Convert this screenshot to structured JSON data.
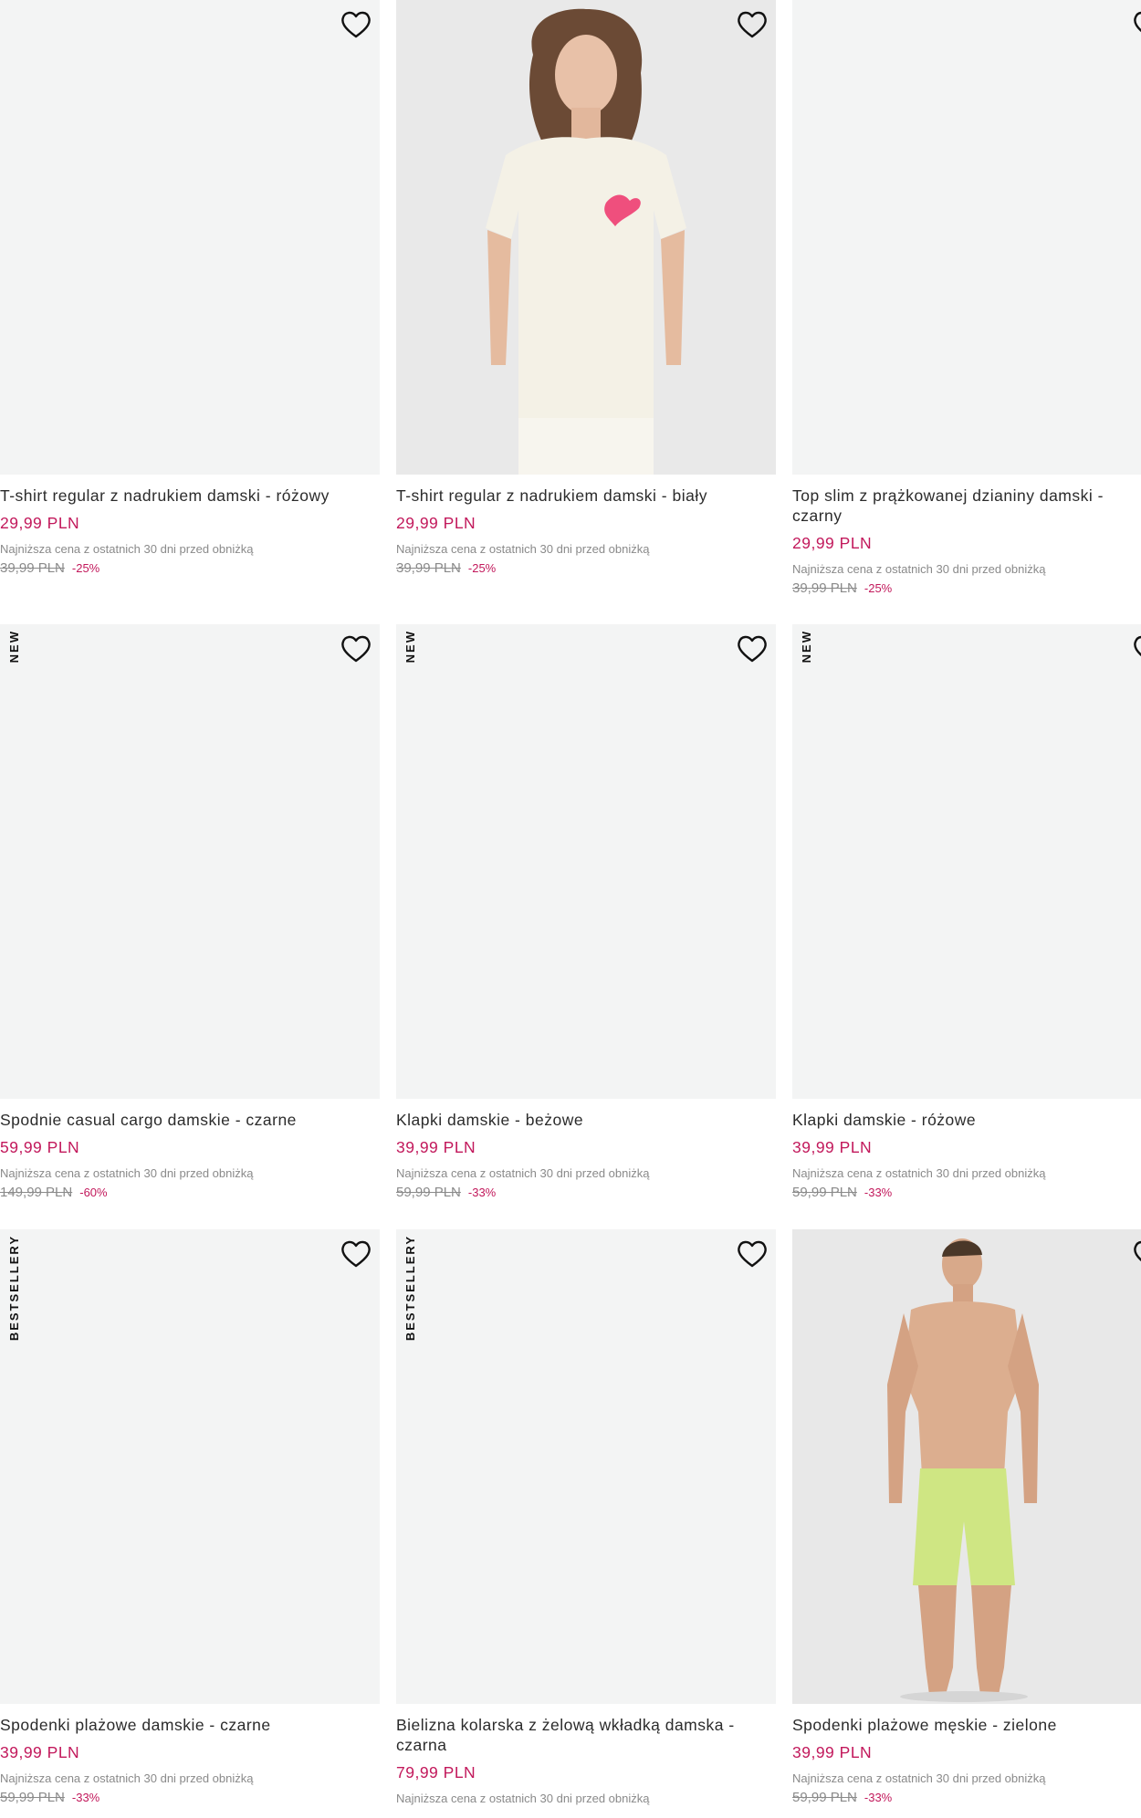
{
  "products": [
    {
      "title": "T-shirt regular z nadrukiem damski - różowy",
      "price": "29,99 PLN",
      "lowest_price_label": "Najniższa cena z ostatnich 30 dni przed obniżką",
      "old_price": "39,99 PLN",
      "discount": "-25%",
      "badge": "",
      "image": "empty"
    },
    {
      "title": "T-shirt regular z nadrukiem damski - biały",
      "price": "29,99 PLN",
      "lowest_price_label": "Najniższa cena z ostatnich 30 dni przed obniżką",
      "old_price": "39,99 PLN",
      "discount": "-25%",
      "badge": "",
      "image": "woman-white-tshirt"
    },
    {
      "title": "Top slim z prążkowanej dzianiny damski - czarny",
      "price": "29,99 PLN",
      "lowest_price_label": "Najniższa cena z ostatnich 30 dni przed obniżką",
      "old_price": "39,99 PLN",
      "discount": "-25%",
      "badge": "",
      "image": "empty"
    },
    {
      "title": "Spodnie casual cargo damskie - czarne",
      "price": "59,99 PLN",
      "lowest_price_label": "Najniższa cena z ostatnich 30 dni przed obniżką",
      "old_price": "149,99 PLN",
      "discount": "-60%",
      "badge": "NEW",
      "image": "empty"
    },
    {
      "title": "Klapki damskie - beżowe",
      "price": "39,99 PLN",
      "lowest_price_label": "Najniższa cena z ostatnich 30 dni przed obniżką",
      "old_price": "59,99 PLN",
      "discount": "-33%",
      "badge": "NEW",
      "image": "empty"
    },
    {
      "title": "Klapki damskie - różowe",
      "price": "39,99 PLN",
      "lowest_price_label": "Najniższa cena z ostatnich 30 dni przed obniżką",
      "old_price": "59,99 PLN",
      "discount": "-33%",
      "badge": "NEW",
      "image": "empty"
    },
    {
      "title": "Spodenki plażowe damskie - czarne",
      "price": "39,99 PLN",
      "lowest_price_label": "Najniższa cena z ostatnich 30 dni przed obniżką",
      "old_price": "59,99 PLN",
      "discount": "-33%",
      "badge": "BESTSELLERY",
      "image": "empty"
    },
    {
      "title": "Bielizna kolarska z żelową wkładką damska - czarna",
      "price": "79,99 PLN",
      "lowest_price_label": "Najniższa cena z ostatnich 30 dni przed obniżką",
      "old_price": "",
      "discount": "",
      "badge": "BESTSELLERY",
      "image": "empty"
    },
    {
      "title": "Spodenki plażowe męskie - zielone",
      "price": "39,99 PLN",
      "lowest_price_label": "Najniższa cena z ostatnich 30 dni przed obniżką",
      "old_price": "59,99 PLN",
      "discount": "-33%",
      "badge": "",
      "image": "man-green-shorts"
    }
  ],
  "icons": {
    "wishlist": "heart-outline-icon"
  },
  "colors": {
    "price": "#c2185b",
    "image_bg": "#f3f4f4",
    "muted_text": "#8a8a8a"
  }
}
